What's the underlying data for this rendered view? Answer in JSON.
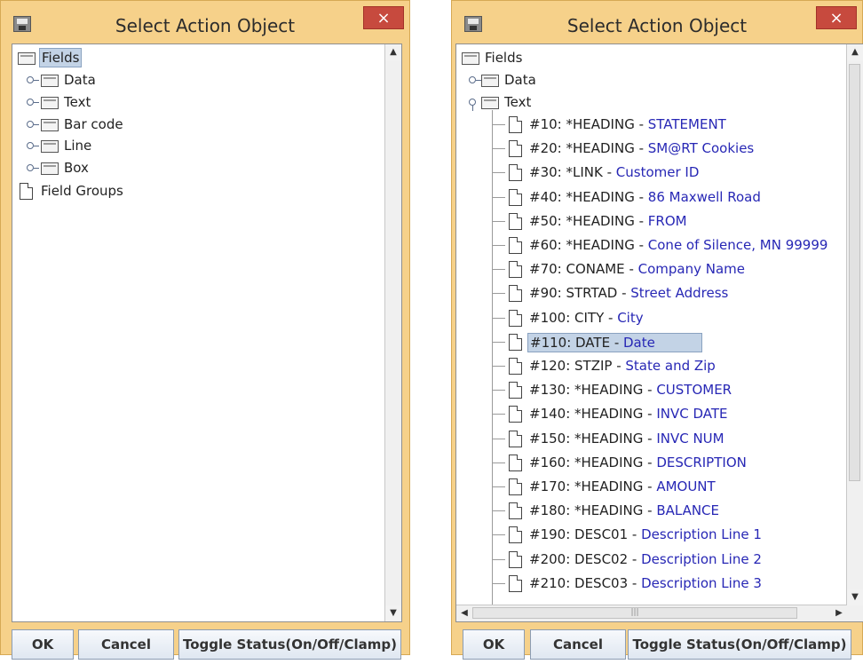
{
  "left_dialog": {
    "title": "Select Action Object",
    "close_symbol": "×",
    "tree": {
      "root": "Fields",
      "children": [
        "Data",
        "Text",
        "Bar code",
        "Line",
        "Box"
      ],
      "groups": "Field Groups"
    },
    "buttons": {
      "ok": "OK",
      "cancel": "Cancel",
      "toggle": "Toggle Status(On/Off/Clamp)"
    }
  },
  "right_dialog": {
    "title": "Select Action Object",
    "close_symbol": "×",
    "tree": {
      "root": "Fields",
      "data": "Data",
      "text": "Text",
      "text_items": [
        {
          "code": "#10: *HEADING",
          "desc": "STATEMENT"
        },
        {
          "code": "#20: *HEADING",
          "desc": "SM@RT Cookies"
        },
        {
          "code": "#30: *LINK",
          "desc": "Customer ID"
        },
        {
          "code": "#40: *HEADING",
          "desc": "86 Maxwell Road"
        },
        {
          "code": "#50: *HEADING",
          "desc": "FROM"
        },
        {
          "code": "#60: *HEADING",
          "desc": "Cone of Silence, MN 99999"
        },
        {
          "code": "#70: CONAME",
          "desc": "Company Name"
        },
        {
          "code": "#90: STRTAD",
          "desc": "Street Address"
        },
        {
          "code": "#100: CITY",
          "desc": "City"
        },
        {
          "code": "#110: DATE",
          "desc": "Date"
        },
        {
          "code": "#120: STZIP",
          "desc": "State and Zip"
        },
        {
          "code": "#130: *HEADING",
          "desc": "CUSTOMER"
        },
        {
          "code": "#140: *HEADING",
          "desc": "INVC DATE"
        },
        {
          "code": "#150: *HEADING",
          "desc": "INVC NUM"
        },
        {
          "code": "#160: *HEADING",
          "desc": "DESCRIPTION"
        },
        {
          "code": "#170: *HEADING",
          "desc": "AMOUNT"
        },
        {
          "code": "#180: *HEADING",
          "desc": "BALANCE"
        },
        {
          "code": "#190: DESC01",
          "desc": "Description Line 1"
        },
        {
          "code": "#200: DESC02",
          "desc": "Description Line 2"
        },
        {
          "code": "#210: DESC03",
          "desc": "Description Line 3"
        }
      ],
      "selected_index": 9
    },
    "hscroll_thumb_mark": "|||",
    "buttons": {
      "ok": "OK",
      "cancel": "Cancel",
      "toggle": "Toggle Status(On/Off/Clamp)"
    }
  },
  "colors": {
    "dialog_frame": "#f6d18a",
    "close_button": "#c74a3e",
    "selection": "#c3d3e6",
    "description_text": "#2727b5"
  }
}
